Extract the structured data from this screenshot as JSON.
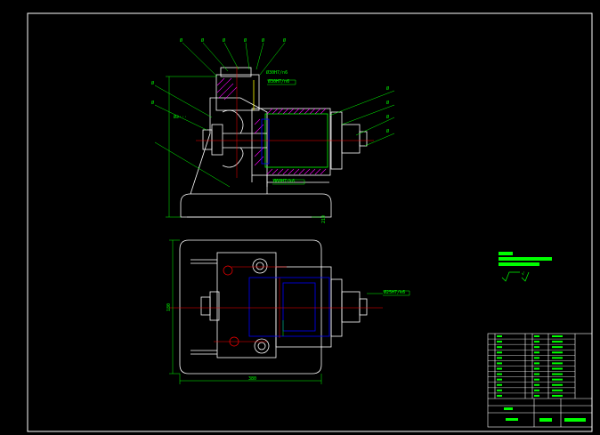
{
  "drawing": {
    "dim_width": "380",
    "dim_height": "180",
    "dim_vertical": "210",
    "balloon_labels": [
      "Ø",
      "Ø",
      "Ø",
      "Ø",
      "Ø",
      "Ø",
      "Ø",
      "Ø",
      "Ø",
      "Ø",
      "Ø",
      "Ø"
    ],
    "tolerance_callouts": [
      "Ø30H7/n6",
      "Ø60H7/k6",
      "Ø∂···",
      "Ø25H7/k6",
      "Ø30H7/n6"
    ],
    "roughness_label": "√"
  },
  "title_block": {
    "rows": 12
  },
  "colors": {
    "background": "#000000",
    "outline": "#ffffff",
    "dimension": "#00ff00",
    "hatch": "#ff00ff",
    "hidden": "#0000ff",
    "centerline": "#ff0000"
  }
}
